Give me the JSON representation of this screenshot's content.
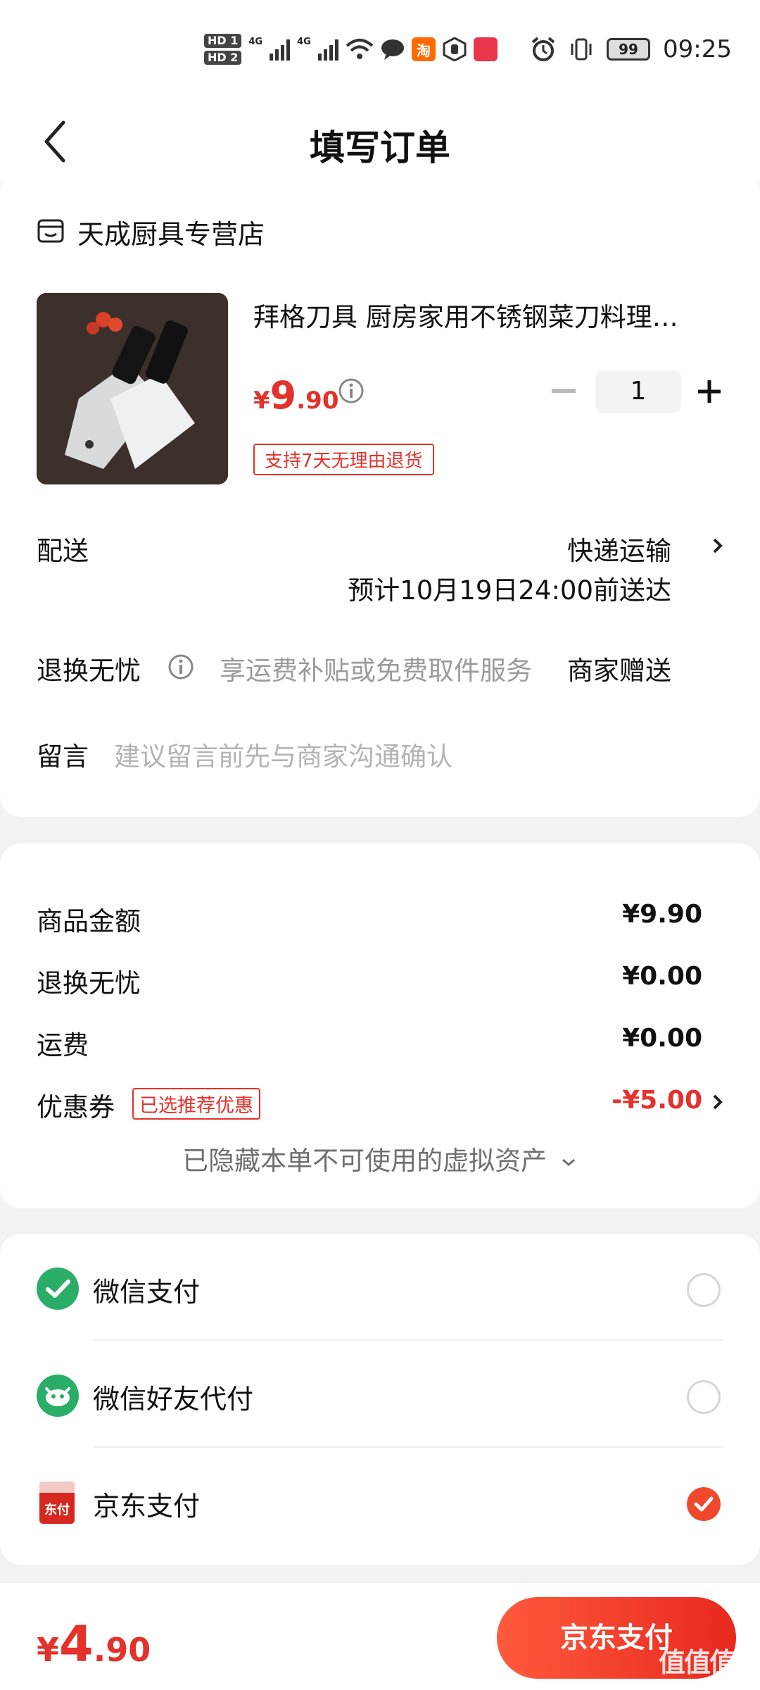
{
  "status_bar": {
    "hd1": "HD 1",
    "hd2": "HD 2",
    "net1": "4G",
    "net2": "4G",
    "app1": "淘",
    "battery": "99",
    "time": "09:25"
  },
  "header": {
    "title": "填写订单"
  },
  "order": {
    "shop_name": "天成厨具专营店",
    "product_title": "拜格刀具 厨房家用不锈钢菜刀料理刀组合套装",
    "price": {
      "yen": "¥",
      "int": "9",
      "dec": ".90"
    },
    "quantity": "1",
    "return_badge": "支持7天无理由退货",
    "delivery_label": "配送",
    "delivery_method": "快递运输",
    "delivery_eta": "预计10月19日24:00前送达",
    "worry_free_label": "退换无忧",
    "worry_free_desc": "享运费补贴或免费取件服务",
    "worry_free_value": "商家赠送",
    "message_label": "留言",
    "message_placeholder": "建议留言前先与商家沟通确认"
  },
  "summary": {
    "rows": [
      {
        "label": "商品金额",
        "value": "¥9.90"
      },
      {
        "label": "退换无忧",
        "value": "¥0.00"
      },
      {
        "label": "运费",
        "value": "¥0.00"
      }
    ],
    "coupon_label": "优惠券",
    "coupon_badge": "已选推荐优惠",
    "coupon_value": "-¥5.00",
    "hidden_note": "已隐藏本单不可使用的虚拟资产"
  },
  "payment": {
    "methods": [
      {
        "label": "微信支付",
        "selected": false
      },
      {
        "label": "微信好友代付",
        "selected": false
      },
      {
        "label": "京东支付",
        "selected": true
      }
    ],
    "jd_icon_text": "东付"
  },
  "footer": {
    "total": {
      "yen": "¥",
      "int": "4",
      "dec": ".90"
    },
    "pay_button": "京东支付",
    "watermark": "值值值"
  },
  "colors": {
    "accent": "#e4312b",
    "wechat_green": "#2aae67",
    "button_start": "#ff5a3c",
    "button_end": "#e8281e"
  }
}
